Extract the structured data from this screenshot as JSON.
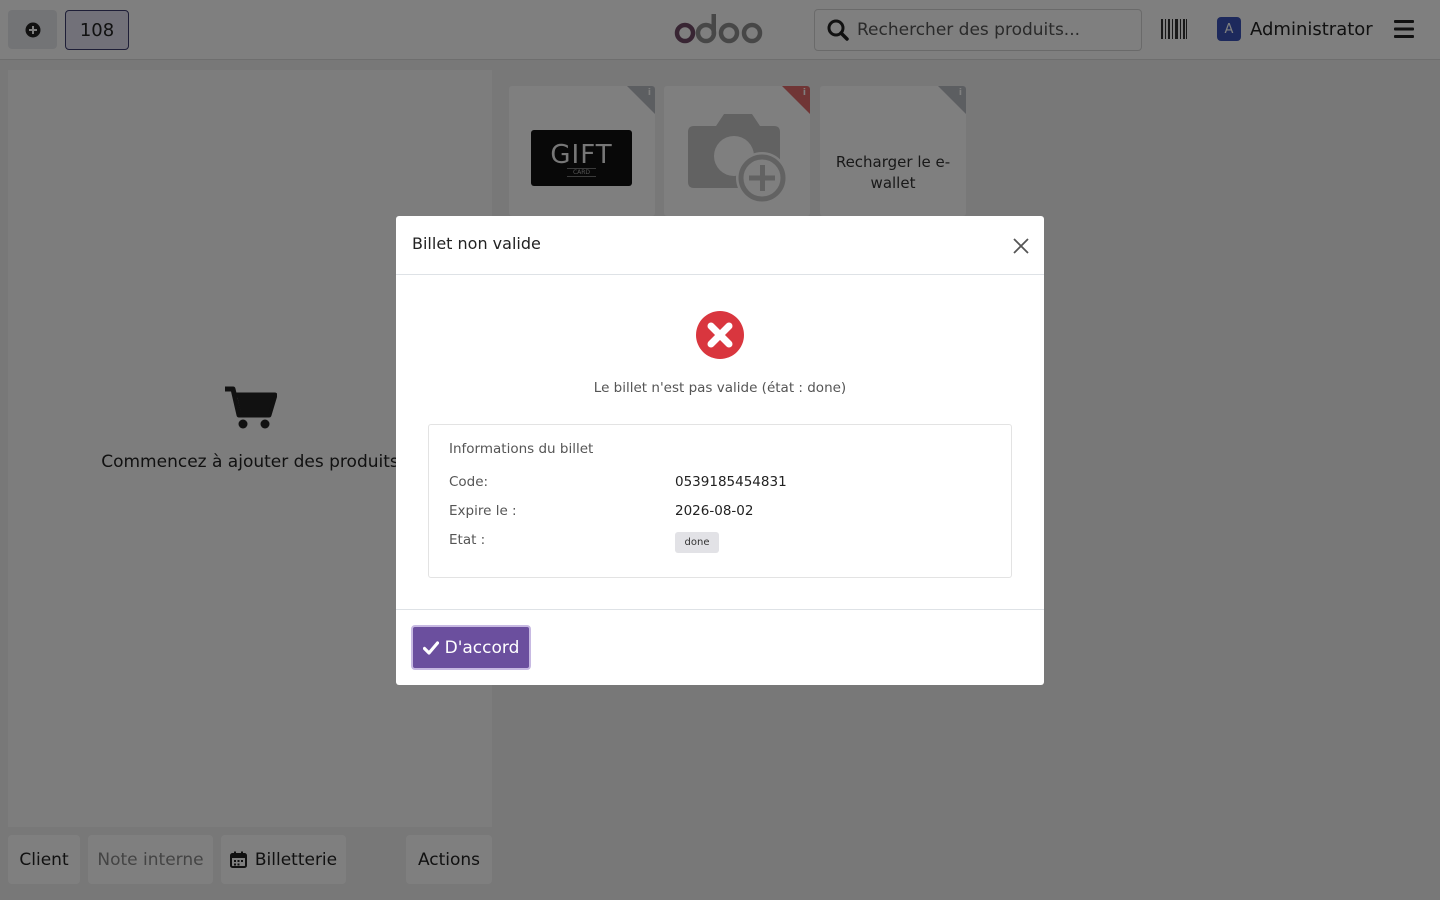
{
  "topbar": {
    "order_number": "108",
    "search_placeholder": "Rechercher des produits...",
    "user_initial": "A",
    "user_name": "Administrator"
  },
  "order_panel": {
    "empty_text": "Commencez à ajouter des produits"
  },
  "bottom_buttons": {
    "client": "Client",
    "note": "Note interne",
    "billetterie": "Billetterie",
    "actions": "Actions"
  },
  "products": [
    {
      "image_text": "GIFT",
      "image_subtext": "CARD",
      "info_icon": "i"
    },
    {
      "info_icon": "i"
    },
    {
      "label": "Recharger le e-wallet",
      "info_icon": "i"
    }
  ],
  "dialog": {
    "title": "Billet non valide",
    "message": "Le billet n'est pas valide (état : done)",
    "info_title": "Informations du billet",
    "rows": [
      {
        "label": "Code:",
        "value": "0539185454831"
      },
      {
        "label": "Expire le :",
        "value": "2026-08-02"
      },
      {
        "label": "Etat :",
        "value": "done"
      }
    ],
    "ok_label": "D'accord"
  },
  "colors": {
    "primary": "#6b4f9e",
    "error": "#d9363e",
    "logo_o": "#714b67",
    "logo_rest": "#8f8f8f"
  }
}
